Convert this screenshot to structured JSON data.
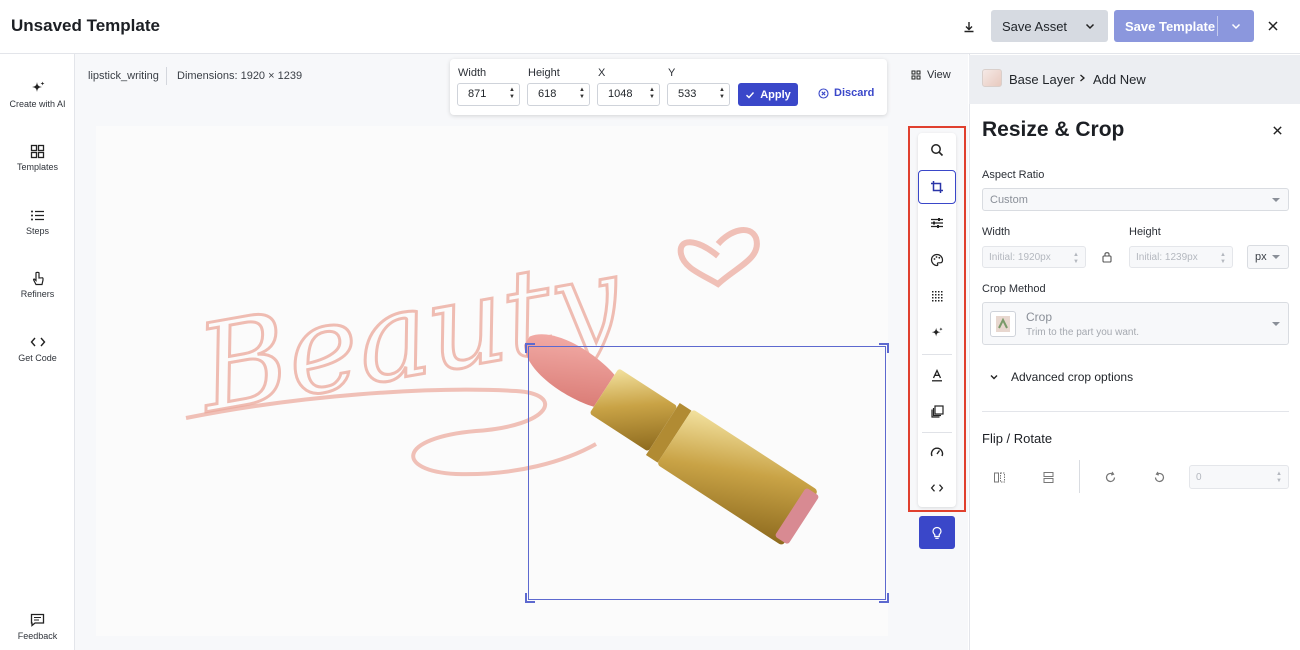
{
  "header": {
    "title": "Unsaved Template",
    "save_asset_label": "Save Asset",
    "save_template_label": "Save Template"
  },
  "leftnav": {
    "items": [
      {
        "label": "Create with AI",
        "icon": "sparkle-icon"
      },
      {
        "label": "Templates",
        "icon": "grid-icon"
      },
      {
        "label": "Steps",
        "icon": "list-icon"
      },
      {
        "label": "Refiners",
        "icon": "pointer-icon"
      },
      {
        "label": "Get Code",
        "icon": "code-icon"
      }
    ],
    "feedback_label": "Feedback"
  },
  "canvas": {
    "filename": "lipstick_writing",
    "dimensions": "Dimensions: 1920 × 1239",
    "view_label": "View",
    "image_text": "Beauty"
  },
  "cropbar": {
    "width_label": "Width",
    "height_label": "Height",
    "x_label": "X",
    "y_label": "Y",
    "width_value": "871",
    "height_value": "618",
    "x_value": "1048",
    "y_value": "533",
    "apply_label": "Apply",
    "discard_label": "Discard"
  },
  "toolbar": {
    "tools": [
      "search-icon",
      "crop-icon",
      "sliders-icon",
      "palette-icon",
      "pattern-icon",
      "sparkle-icon",
      "text-icon",
      "layers-icon",
      "speed-icon",
      "code-icon"
    ],
    "active_tool": "crop-icon"
  },
  "layers": {
    "base_layer_label": "Base Layer",
    "add_new_label": "Add New"
  },
  "panel": {
    "title": "Resize & Crop",
    "aspect_ratio_label": "Aspect Ratio",
    "aspect_ratio_value": "Custom",
    "width_label": "Width",
    "height_label": "Height",
    "width_placeholder": "Initial: 1920px",
    "height_placeholder": "Initial: 1239px",
    "unit_value": "px",
    "crop_method_label": "Crop Method",
    "crop_method_title": "Crop",
    "crop_method_sub": "Trim to the part you want.",
    "advanced_label": "Advanced crop options",
    "flip_rotate_label": "Flip / Rotate",
    "rotate_value": "0"
  },
  "colors": {
    "accent": "#3a47c9",
    "highlight_outline": "#e0402e"
  }
}
